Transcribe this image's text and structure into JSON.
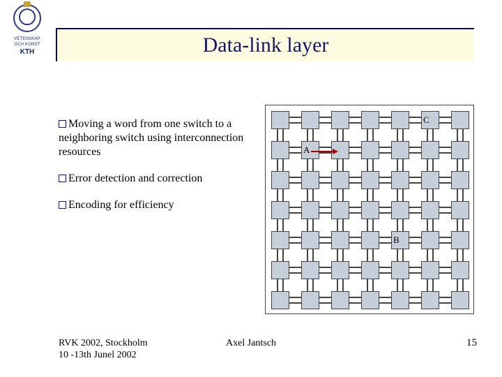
{
  "logo": {
    "line1": "VETENSKAP",
    "line2": "OCH KONST",
    "kth": "KTH"
  },
  "title": "Data-link layer",
  "bullets": [
    "Moving a word from one switch to a neighboring switch using interconnection resources",
    "Error detection and correction",
    "Encoding for efficiency"
  ],
  "grid": {
    "rows": 7,
    "cols": 7,
    "nodes": {
      "A": {
        "label": "A",
        "row": 1,
        "col": 1
      },
      "B": {
        "label": "B",
        "row": 4,
        "col": 4
      },
      "C": {
        "label": "C",
        "row": 0,
        "col": 5
      }
    }
  },
  "footer": {
    "venue_line1": "RVK 2002, Stockholm",
    "venue_line2": "10 -13th Junel 2002",
    "author": "Axel Jantsch",
    "page": "15"
  }
}
